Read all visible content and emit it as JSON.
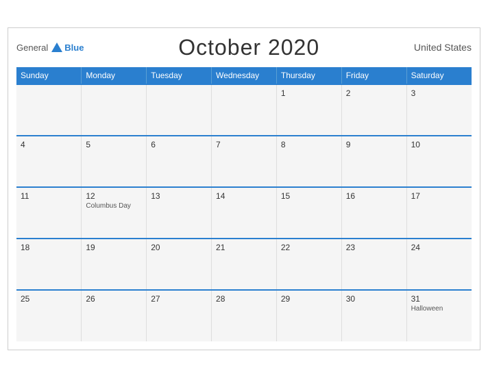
{
  "header": {
    "logo_general": "General",
    "logo_blue": "Blue",
    "title": "October 2020",
    "country": "United States"
  },
  "weekdays": [
    "Sunday",
    "Monday",
    "Tuesday",
    "Wednesday",
    "Thursday",
    "Friday",
    "Saturday"
  ],
  "weeks": [
    [
      {
        "day": "",
        "event": ""
      },
      {
        "day": "",
        "event": ""
      },
      {
        "day": "",
        "event": ""
      },
      {
        "day": "",
        "event": ""
      },
      {
        "day": "1",
        "event": ""
      },
      {
        "day": "2",
        "event": ""
      },
      {
        "day": "3",
        "event": ""
      }
    ],
    [
      {
        "day": "4",
        "event": ""
      },
      {
        "day": "5",
        "event": ""
      },
      {
        "day": "6",
        "event": ""
      },
      {
        "day": "7",
        "event": ""
      },
      {
        "day": "8",
        "event": ""
      },
      {
        "day": "9",
        "event": ""
      },
      {
        "day": "10",
        "event": ""
      }
    ],
    [
      {
        "day": "11",
        "event": ""
      },
      {
        "day": "12",
        "event": "Columbus Day"
      },
      {
        "day": "13",
        "event": ""
      },
      {
        "day": "14",
        "event": ""
      },
      {
        "day": "15",
        "event": ""
      },
      {
        "day": "16",
        "event": ""
      },
      {
        "day": "17",
        "event": ""
      }
    ],
    [
      {
        "day": "18",
        "event": ""
      },
      {
        "day": "19",
        "event": ""
      },
      {
        "day": "20",
        "event": ""
      },
      {
        "day": "21",
        "event": ""
      },
      {
        "day": "22",
        "event": ""
      },
      {
        "day": "23",
        "event": ""
      },
      {
        "day": "24",
        "event": ""
      }
    ],
    [
      {
        "day": "25",
        "event": ""
      },
      {
        "day": "26",
        "event": ""
      },
      {
        "day": "27",
        "event": ""
      },
      {
        "day": "28",
        "event": ""
      },
      {
        "day": "29",
        "event": ""
      },
      {
        "day": "30",
        "event": ""
      },
      {
        "day": "31",
        "event": "Halloween"
      }
    ]
  ]
}
